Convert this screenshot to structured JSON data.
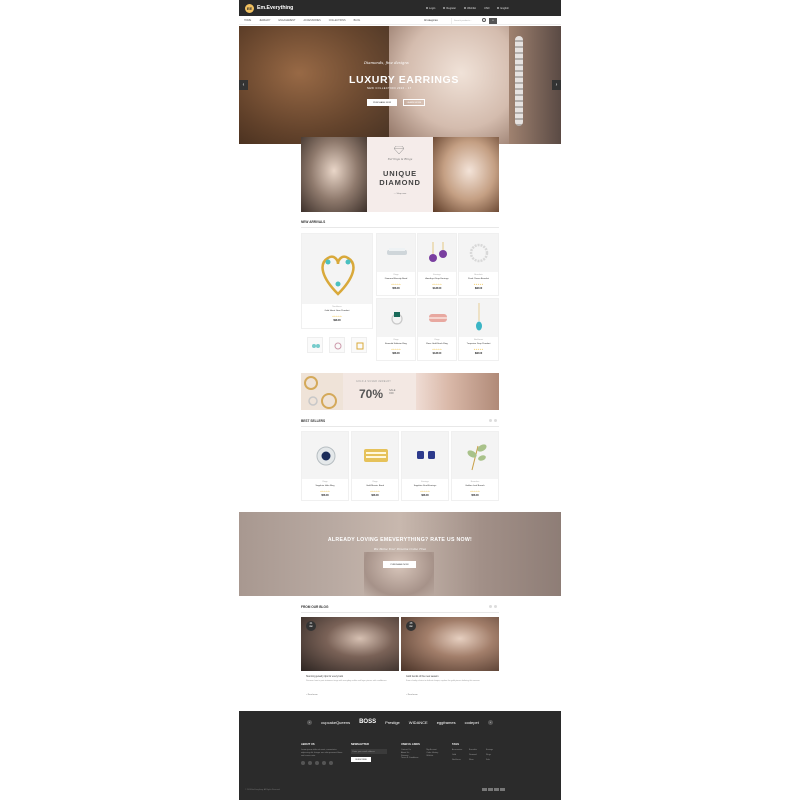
{
  "header": {
    "logo_text": "Em.Everything",
    "logo_mark": "EE",
    "top_links": [
      "Login",
      "Register",
      "Wishlist",
      "USD",
      "English"
    ]
  },
  "nav": {
    "items": [
      "HOME",
      "JEWELRY",
      "ENGAGEMENT",
      "ACCESSORIES",
      "COLLECTIONS",
      "BLOG"
    ],
    "category_select": "All categories",
    "search_placeholder": "Search products...",
    "cart_count": "0"
  },
  "hero": {
    "tagline": "Diamonds, fine designs",
    "title": "LUXURY EARRINGS",
    "subtitle": "NEW COLLECTION 2016 - 17",
    "btn_primary": "PURCHASE NOW",
    "btn_secondary": "LEARN MORE",
    "prev_arrow": "‹",
    "next_arrow": "›"
  },
  "diamond_banner": {
    "tagline": "Earrings & Rings",
    "title_line1": "UNIQUE",
    "title_line2": "DIAMOND",
    "link": "— Shop now"
  },
  "new_arrivals": {
    "title": "NEW ARRIVALS",
    "featured": {
      "category": "Necklaces",
      "name": "Gold Heart Gem Pendant",
      "stars": "★★★★★",
      "price": "$98.00"
    },
    "products": [
      {
        "category": "Rings",
        "name": "Diamond Eternity Band",
        "stars": "★★★★★",
        "price": "$58.00"
      },
      {
        "category": "Earrings",
        "name": "Amethyst Drop Earrings",
        "stars": "★★★★★",
        "price": "$128.00"
      },
      {
        "category": "Bracelets",
        "name": "Pearl Charm Bracelet",
        "stars": "★★★★★",
        "price": "$98.00"
      },
      {
        "category": "Rings",
        "name": "Emerald Solitaire Ring",
        "stars": "★★★★★",
        "price": "$68.00"
      },
      {
        "category": "Rings",
        "name": "Rose Gold Stack Ring",
        "stars": "★★★★★",
        "price": "$128.00"
      },
      {
        "category": "Necklaces",
        "name": "Turquoise Drop Pendant",
        "stars": "★★★★★",
        "price": "$98.00"
      }
    ]
  },
  "sale_banner": {
    "tag": "GOLD & SILVER JEWELRY",
    "percent": "70%",
    "sale_line1": "SALE",
    "sale_line2": "OFF"
  },
  "best_sellers": {
    "title": "BEST SELLERS",
    "products": [
      {
        "category": "Rings",
        "name": "Sapphire Halo Ring",
        "stars": "★★★★★",
        "price": "$58.00"
      },
      {
        "category": "Rings",
        "name": "Gold Mosaic Band",
        "stars": "★★★★★",
        "price": "$68.00"
      },
      {
        "category": "Earrings",
        "name": "Sapphire Stud Earrings",
        "stars": "★★★★★",
        "price": "$68.00"
      },
      {
        "category": "Brooches",
        "name": "Golden Leaf Brooch",
        "stars": "★★★★★",
        "price": "$58.00"
      }
    ]
  },
  "rate_banner": {
    "title": "ALREADY LOVING EMEVERYTHING? RATE US NOW!",
    "subtitle": "We Make Your Dreams Come True",
    "button": "PURCHASE NOW"
  },
  "blog": {
    "title": "FROM OUR BLOG",
    "posts": [
      {
        "day": "21",
        "month": "Jan",
        "title": "Stunning jewelry tips for every look",
        "text": "Discover how to pair statement rings with everyday outfits and layer pieces with confidence.",
        "more": "+ Read more"
      },
      {
        "day": "28",
        "month": "Jan",
        "title": "Gold trends of the new season",
        "text": "From chunky chains to delicate hoops, explore the gold pieces defining this season.",
        "more": "+ Read more"
      }
    ]
  },
  "footer": {
    "brands": [
      "cupcakeQueens",
      "BOSS",
      "Prestige",
      "WIDANCE",
      "eggframes",
      "codepet"
    ],
    "about": {
      "heading": "ABOUT US",
      "text": "Lorem ipsum dolor sit amet, consectetur adipiscing elit. Integer nec odio praesent libero sed cursus ante."
    },
    "newsletter": {
      "heading": "NEWSLETTER",
      "placeholder": "Enter your email address",
      "button": "SUBSCRIBE"
    },
    "useful_links": {
      "heading": "USEFUL LINKS",
      "col1": [
        "Contact Us",
        "About Us",
        "Sitemap",
        "Terms & Conditions"
      ],
      "col2": [
        "My Account",
        "Order History",
        "Wishlist"
      ]
    },
    "tags": {
      "heading": "TAGS",
      "items": [
        "Accessories",
        "Bracelets",
        "Earrings",
        "Gold",
        "Diamond",
        "Rings",
        "Necklaces",
        "Silver",
        "Sale"
      ]
    },
    "copyright": "© 2016 Em.Everything. All Rights Reserved."
  }
}
